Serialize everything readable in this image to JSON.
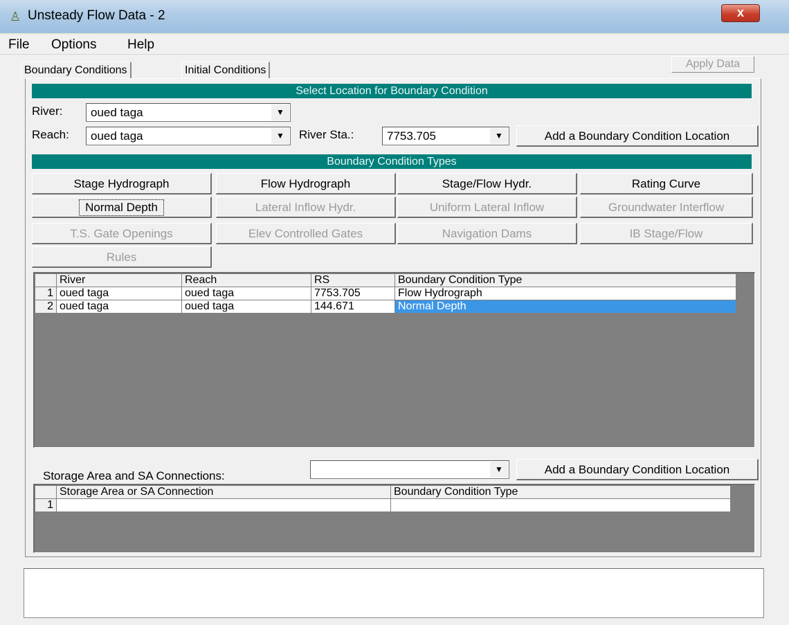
{
  "window": {
    "title": "Unsteady Flow Data - 2",
    "close_label": "x"
  },
  "menu": [
    "File",
    "Options",
    "Help"
  ],
  "tabs": [
    "Boundary Conditions",
    "Initial Conditions"
  ],
  "apply_label": "Apply Data",
  "location": {
    "header": "Select Location for Boundary Condition",
    "river_label": "River:",
    "river_value": "oued taga",
    "reach_label": "Reach:",
    "reach_value": "oued taga",
    "station_label": "River Sta.:",
    "station_value": "7753.705",
    "add_label": "Add a Boundary Condition Location"
  },
  "types": {
    "header": "Boundary Condition Types",
    "buttons": [
      [
        "Stage Hydrograph",
        "Flow Hydrograph",
        "Stage/Flow Hydr.",
        "Rating Curve"
      ],
      [
        "Normal Depth",
        "Lateral Inflow Hydr.",
        "Uniform Lateral Inflow",
        "Groundwater Interflow"
      ],
      [
        "T.S. Gate Openings",
        "Elev Controlled Gates",
        "Navigation Dams",
        "IB Stage/Flow"
      ],
      [
        "Rules"
      ]
    ]
  },
  "bc_table": {
    "headers": [
      "River",
      "Reach",
      "RS",
      "Boundary Condition Type"
    ],
    "rows": [
      [
        "1",
        "oued taga",
        "oued taga",
        "7753.705",
        "Flow Hydrograph"
      ],
      [
        "2",
        "oued taga",
        "oued taga",
        "144.671",
        "Normal Depth"
      ]
    ]
  },
  "storage": {
    "label": "Storage Area and SA Connections:",
    "value": "",
    "add_label": "Add a Boundary Condition Location",
    "headers": [
      "Storage Area or SA Connection",
      "Boundary Condition Type"
    ],
    "rows": [
      [
        "1",
        "",
        ""
      ]
    ]
  },
  "message": ""
}
